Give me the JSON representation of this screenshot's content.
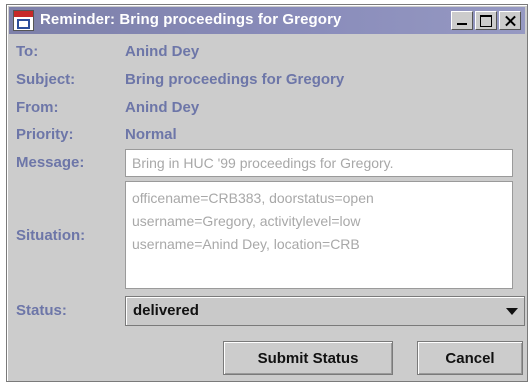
{
  "window": {
    "title": "Reminder: Bring proceedings for Gregory",
    "icon": "app-window-icon"
  },
  "fields": {
    "to": {
      "label": "To:",
      "value": "Anind Dey"
    },
    "subject": {
      "label": "Subject:",
      "value": "Bring proceedings for Gregory"
    },
    "from": {
      "label": "From:",
      "value": "Anind Dey"
    },
    "priority": {
      "label": "Priority:",
      "value": "Normal"
    },
    "message": {
      "label": "Message:",
      "value": "Bring in HUC '99 proceedings for Gregory."
    },
    "situation": {
      "label": "Situation:",
      "lines": [
        "officename=CRB383, doorstatus=open",
        "username=Gregory, activitylevel=low",
        "username=Anind Dey, location=CRB"
      ]
    },
    "status": {
      "label": "Status:",
      "value": "delivered"
    }
  },
  "buttons": {
    "submit": "Submit Status",
    "cancel": "Cancel"
  },
  "colors": {
    "titlebar": "#8a8dbb",
    "label": "#6d76a8",
    "window_bg": "#cccccc"
  }
}
